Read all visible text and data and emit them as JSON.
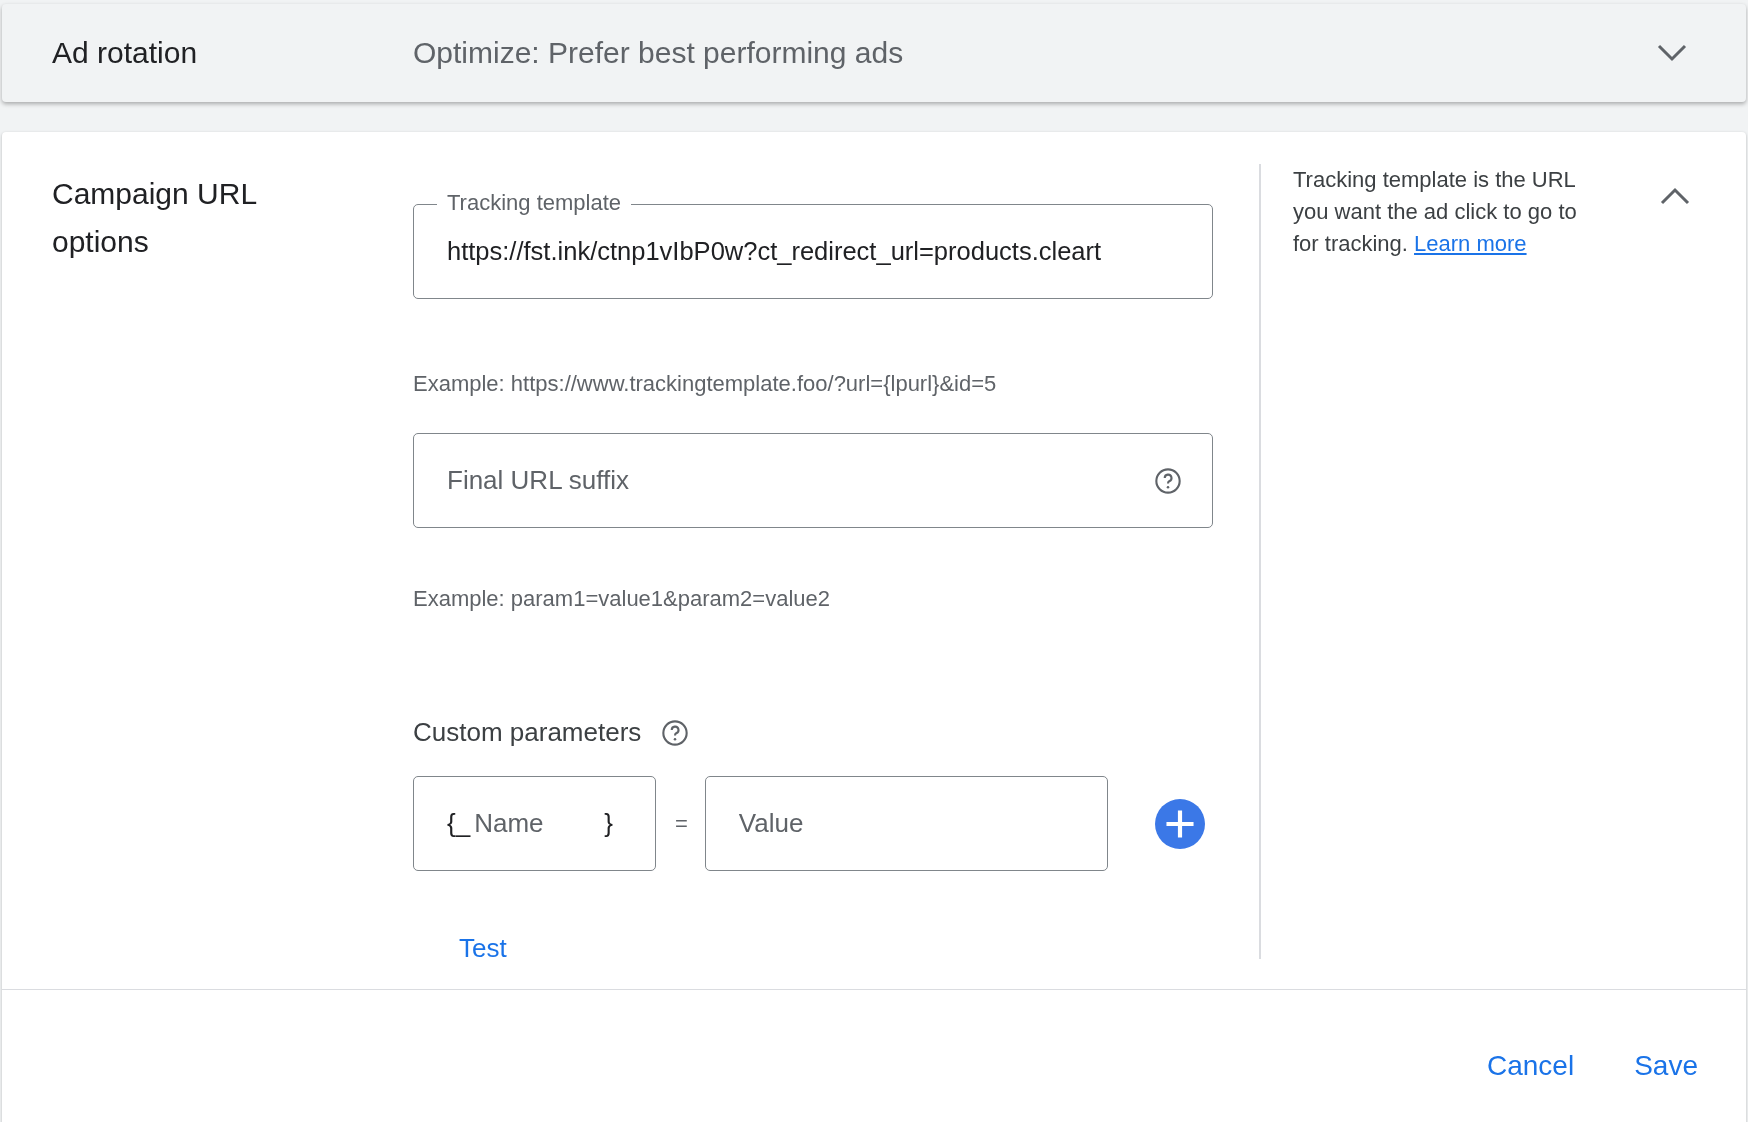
{
  "ad_rotation": {
    "label": "Ad rotation",
    "value": "Optimize: Prefer best performing ads",
    "expanded": false
  },
  "section": {
    "title": "Campaign URL options",
    "expanded": true,
    "tracking_template": {
      "label": "Tracking template",
      "value": "https://fst.ink/ctnp1vIbP0w?ct_redirect_url=products.cleart",
      "example": "Example: https://www.trackingtemplate.foo/?url={lpurl}&id=5"
    },
    "final_url_suffix": {
      "placeholder": "Final URL suffix",
      "example": "Example: param1=value1&param2=value2"
    },
    "custom_parameters": {
      "label": "Custom parameters",
      "name_prefix": "{_",
      "name_placeholder": "Name",
      "name_suffix": "}",
      "equals": "=",
      "value_placeholder": "Value",
      "test": "Test"
    },
    "help": {
      "text": "Tracking template is the URL you want the ad click to go to for tracking.",
      "link": "Learn more"
    }
  },
  "footer": {
    "buttons": [
      "Cancel",
      "Save"
    ]
  }
}
